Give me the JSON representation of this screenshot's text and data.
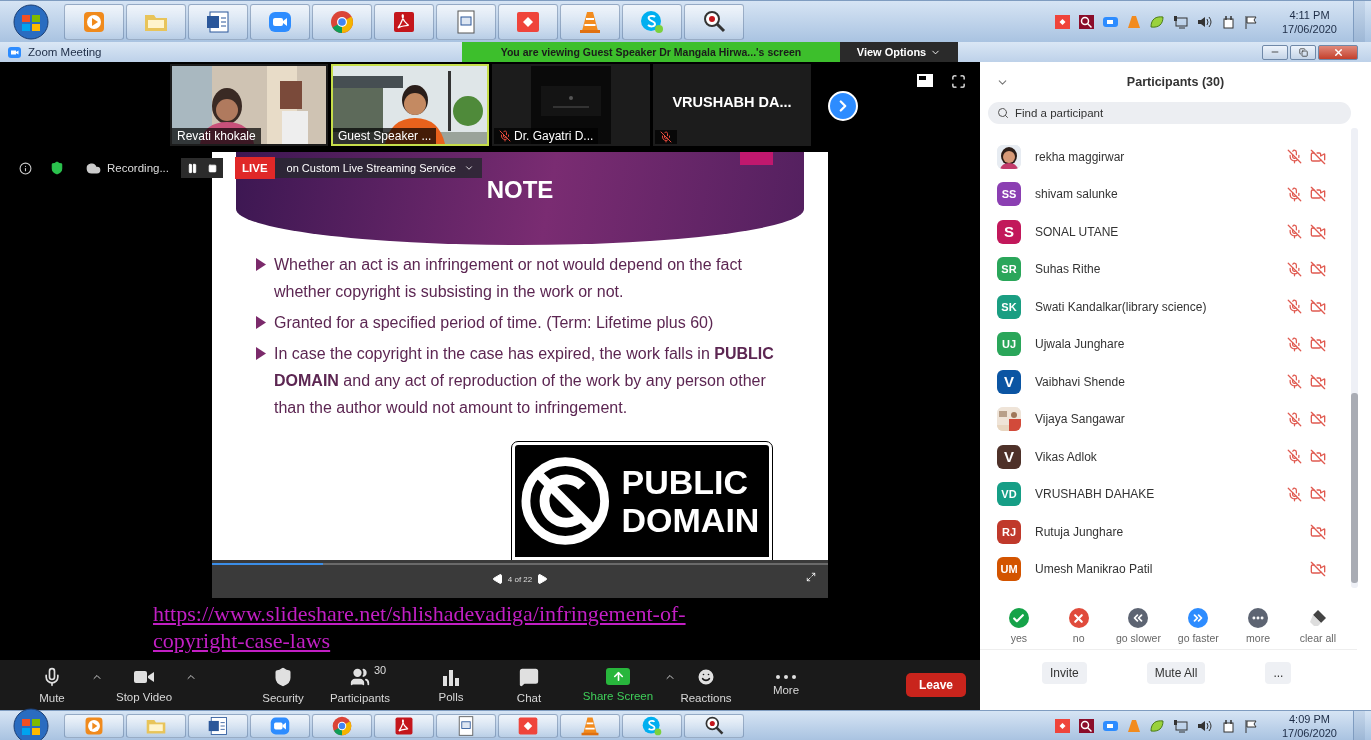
{
  "taskbar_top": {
    "clock": {
      "time": "4:11 PM",
      "date": "17/06/2020"
    }
  },
  "window": {
    "title": "Zoom Meeting"
  },
  "share_banner": "You are viewing Guest Speaker Dr Mangala Hirwa...'s screen",
  "view_options": "View Options",
  "videos": [
    {
      "name": "Revati khokale",
      "kind": "video",
      "active": false,
      "mic_muted": false
    },
    {
      "name": "Guest Speaker ...",
      "kind": "video",
      "active": true,
      "mic_muted": false
    },
    {
      "name": "Dr. Gayatri D...",
      "kind": "dark",
      "active": false,
      "mic_muted": true
    },
    {
      "name": "VRUSHABH DA...",
      "kind": "name",
      "active": false,
      "mic_muted": true
    }
  ],
  "recording": {
    "label": "Recording...",
    "live": "LIVE",
    "service": "on Custom Live Streaming Service"
  },
  "slide": {
    "title": "NOTE",
    "bullets": [
      "Whether an act is an infringement or not would depend on  the fact whether copyright is subsisting in the work or not.",
      "Granted for a specified period of time. (Term: Lifetime plus 60)",
      "In case the copyright in the case has expired, the work falls in **PUBLIC DOMAIN** and any act of reproduction of the work by any person other than the author would not amount to infringement."
    ],
    "sign": "PUBLIC DOMAIN",
    "page": "4 of 22",
    "level": 0.18
  },
  "link": "https://www.slideshare.net/shlishadevadiga/infringement-of-copyright-case-laws",
  "toolbar": [
    {
      "kind": "mute",
      "label": "Mute",
      "caret": true
    },
    {
      "kind": "video",
      "label": "Stop Video",
      "caret": true
    },
    {
      "kind": "security",
      "label": "Security",
      "caret": false
    },
    {
      "kind": "participants",
      "label": "Participants",
      "count": "30",
      "caret": false
    },
    {
      "kind": "polls",
      "label": "Polls",
      "caret": false
    },
    {
      "kind": "chat",
      "label": "Chat",
      "caret": false
    },
    {
      "kind": "share",
      "label": "Share Screen",
      "caret": true
    },
    {
      "kind": "reactions",
      "label": "Reactions",
      "caret": false
    },
    {
      "kind": "more",
      "label": "More",
      "caret": false
    }
  ],
  "leave": "Leave",
  "participants": {
    "title": "Participants (30)",
    "search": {
      "placeholder": "Find a participant"
    },
    "list": [
      {
        "name": "rekha maggirwar",
        "kind": "picture",
        "mic_muted": true,
        "video_off": true
      },
      {
        "name": "shivam salunke",
        "kind": "initials",
        "initials": "SS",
        "color": "#8b3fb2",
        "mic_muted": true,
        "video_off": true
      },
      {
        "name": "SONAL UTANE",
        "kind": "initials",
        "initials": "S",
        "color": "#c2185b",
        "mic_muted": true,
        "video_off": true
      },
      {
        "name": "Suhas Rithe",
        "kind": "initials",
        "initials": "SR",
        "color": "#2aa65a",
        "mic_muted": true,
        "video_off": true
      },
      {
        "name": "Swati Kandalkar(library science)",
        "kind": "initials",
        "initials": "SK",
        "color": "#1a9e82",
        "mic_muted": true,
        "video_off": true
      },
      {
        "name": "Ujwala Junghare",
        "kind": "initials",
        "initials": "UJ",
        "color": "#2aa65a",
        "mic_muted": true,
        "video_off": true
      },
      {
        "name": "Vaibhavi Shende",
        "kind": "initials",
        "initials": "V",
        "color": "#0b55a3",
        "mic_muted": true,
        "video_off": true
      },
      {
        "name": "Vijaya Sangawar",
        "kind": "picture",
        "mic_muted": true,
        "video_off": true
      },
      {
        "name": "Vikas Adlok",
        "kind": "initials",
        "initials": "V",
        "color": "#4e3129",
        "mic_muted": true,
        "video_off": true
      },
      {
        "name": "VRUSHABH DAHAKE",
        "kind": "initials",
        "initials": "VD",
        "color": "#169e86",
        "mic_muted": true,
        "video_off": true
      },
      {
        "name": "Rutuja Junghare",
        "kind": "initials",
        "initials": "RJ",
        "color": "#c0392b",
        "mic_muted": false,
        "video_off": true
      },
      {
        "name": "Umesh Manikrao Patil",
        "kind": "initials",
        "initials": "UM",
        "color": "#d35400",
        "mic_muted": false,
        "video_off": true
      }
    ],
    "feedback": [
      {
        "kind": "yes",
        "label": "yes"
      },
      {
        "kind": "no",
        "label": "no"
      },
      {
        "kind": "slower",
        "label": "go slower"
      },
      {
        "kind": "faster",
        "label": "go faster"
      },
      {
        "kind": "more",
        "label": "more"
      },
      {
        "kind": "clear",
        "label": "clear all"
      }
    ],
    "buttons": [
      "Invite",
      "Mute All",
      "..."
    ]
  },
  "taskbar_bottom": {
    "clock": {
      "time": "4:09 PM",
      "date": "17/06/2020"
    }
  }
}
